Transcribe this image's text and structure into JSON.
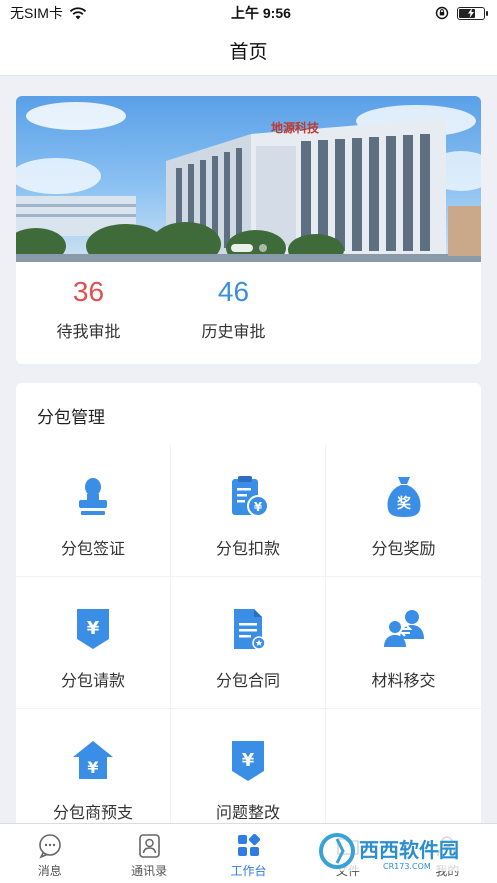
{
  "status": {
    "carrier": "无SIM卡",
    "time": "上午 9:56"
  },
  "nav": {
    "title": "首页"
  },
  "banner": {
    "sign_text": "地源科技"
  },
  "stats": [
    {
      "value": "36",
      "label": "待我审批",
      "color": "#e05050"
    },
    {
      "value": "46",
      "label": "历史审批",
      "color": "#3d8fdc"
    }
  ],
  "menu": {
    "title": "分包管理",
    "items": [
      {
        "label": "分包签证",
        "icon": "seal-icon"
      },
      {
        "label": "分包扣款",
        "icon": "clipboard-yen-icon"
      },
      {
        "label": "分包奖励",
        "icon": "money-bag-icon"
      },
      {
        "label": "分包请款",
        "icon": "yen-down-icon"
      },
      {
        "label": "分包合同",
        "icon": "contract-doc-icon"
      },
      {
        "label": "材料移交",
        "icon": "transfer-users-icon"
      },
      {
        "label": "分包商预支",
        "icon": "house-yen-icon"
      },
      {
        "label": "问题整改",
        "icon": "yen-down-icon"
      }
    ]
  },
  "tabs": [
    {
      "label": "消息",
      "icon": "chat-bubble-icon",
      "active": false
    },
    {
      "label": "通讯录",
      "icon": "contacts-icon",
      "active": false
    },
    {
      "label": "工作台",
      "icon": "grid-apps-icon",
      "active": true
    },
    {
      "label": "文件",
      "icon": "folder-icon",
      "active": false
    },
    {
      "label": "我的",
      "icon": "user-icon",
      "active": false
    }
  ],
  "watermark": {
    "brand": "西西软件园",
    "url": "CR173.COM"
  },
  "colors": {
    "accent": "#2f7de1",
    "icon_blue": "#3a8ee6"
  }
}
